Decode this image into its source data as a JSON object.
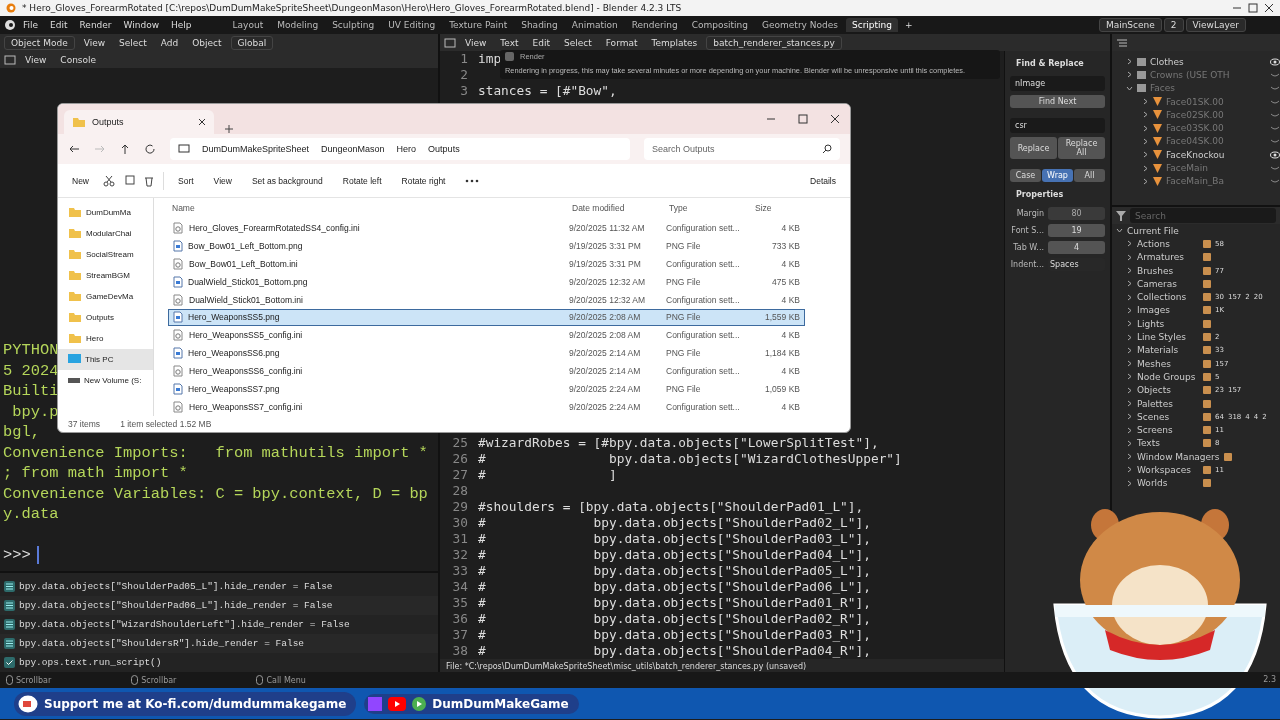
{
  "window": {
    "title": "* Hero_Gloves_ForearmRotated [C:\\repos\\DumDumMakeSpriteSheet\\DungeonMason\\Hero\\Hero_Gloves_ForearmRotated.blend] - Blender 4.2.3 LTS"
  },
  "menu": [
    "File",
    "Edit",
    "Render",
    "Window",
    "Help"
  ],
  "workspaces": [
    {
      "label": "Layout",
      "selected": false
    },
    {
      "label": "Modeling",
      "selected": false
    },
    {
      "label": "Sculpting",
      "selected": false
    },
    {
      "label": "UV Editing",
      "selected": false
    },
    {
      "label": "Texture Paint",
      "selected": false
    },
    {
      "label": "Shading",
      "selected": false
    },
    {
      "label": "Animation",
      "selected": false
    },
    {
      "label": "Rendering",
      "selected": false
    },
    {
      "label": "Compositing",
      "selected": false
    },
    {
      "label": "Geometry Nodes",
      "selected": false
    },
    {
      "label": "Scripting",
      "selected": true
    }
  ],
  "add_workspace": "+",
  "scene": {
    "name": "MainScene",
    "count": "2",
    "view_layer": "ViewLayer"
  },
  "viewport_header": {
    "mode": "Object Mode",
    "menus": [
      "View",
      "Select",
      "Add",
      "Object"
    ],
    "orientation": "Global"
  },
  "console": {
    "menus": [
      "View",
      "Console"
    ],
    "lines": [
      "PYTHON",
      "5 2024",
      "Builti",
      " bpy.p",
      "bgl,",
      "Convenience Imports:   from mathutils import *",
      "; from math import *",
      "Convenience Variables: C = bpy.context, D = bp",
      "y.data"
    ],
    "prompt": ">>>"
  },
  "info": [
    {
      "kind": "property",
      "text": "bpy.data.objects[\"ShoulderPad05_L\"].hide_render = False"
    },
    {
      "kind": "property",
      "text": "bpy.data.objects[\"ShoulderPad06_L\"].hide_render = False"
    },
    {
      "kind": "property",
      "text": "bpy.data.objects[\"WizardShoulderLeft\"].hide_render = False"
    },
    {
      "kind": "property",
      "text": "bpy.data.objects[\"ShouldersR\"].hide_render = False"
    },
    {
      "kind": "operator",
      "text": "bpy.ops.text.run_script()"
    }
  ],
  "text_editor": {
    "menus": [
      "View",
      "Text",
      "Edit",
      "Select",
      "Format",
      "Templates"
    ],
    "filename": "batch_renderer_stances.py",
    "lines_top": [
      {
        "n": "1",
        "text": "imp"
      },
      {
        "n": "2"
      },
      {
        "n": "3",
        "text": "stances = [#\"Bow\","
      }
    ],
    "lines_bottom": [
      {
        "n": "25",
        "text": "#wizardRobes = [#bpy.data.objects[\"LowerSplitTest\"],"
      },
      {
        "n": "26",
        "text": "#                bpy.data.objects[\"WizardClothesUpper\"]"
      },
      {
        "n": "27",
        "text": "#                ]"
      },
      {
        "n": "28"
      },
      {
        "n": "29",
        "text": "#shoulders = [bpy.data.objects[\"ShoulderPad01_L\"],"
      },
      {
        "n": "30",
        "text": "#              bpy.data.objects[\"ShoulderPad02_L\"],"
      },
      {
        "n": "31",
        "text": "#              bpy.data.objects[\"ShoulderPad03_L\"],"
      },
      {
        "n": "32",
        "text": "#              bpy.data.objects[\"ShoulderPad04_L\"],"
      },
      {
        "n": "33",
        "text": "#              bpy.data.objects[\"ShoulderPad05_L\"],"
      },
      {
        "n": "34",
        "text": "#              bpy.data.objects[\"ShoulderPad06_L\"],"
      },
      {
        "n": "35",
        "text": "#              bpy.data.objects[\"ShoulderPad01_R\"],"
      },
      {
        "n": "36",
        "text": "#              bpy.data.objects[\"ShoulderPad02_R\"],"
      },
      {
        "n": "37",
        "text": "#              bpy.data.objects[\"ShoulderPad03_R\"],"
      },
      {
        "n": "38",
        "text": "#              bpy.data.objects[\"ShoulderPad04_R\"],"
      }
    ],
    "status": "File: *C:\\repos\\DumDumMakeSpriteSheet\\misc_utils\\batch_renderer_stances.py (unsaved)"
  },
  "render_notice": {
    "title": "Render",
    "message": "Rendering in progress, this may take several minutes or more depending on your machine. Blender will be unresponsive until this completes."
  },
  "find_replace": {
    "title": "Find & Replace",
    "find": "nImage",
    "find_button": "Find Next",
    "replace": "csr",
    "replace_button": "Replace",
    "replace_all_button": "Replace All",
    "options": [
      {
        "label": "Case",
        "selected": false
      },
      {
        "label": "Wrap",
        "selected": true
      },
      {
        "label": "All",
        "selected": false
      }
    ],
    "properties_title": "Properties",
    "properties": [
      {
        "label": "Margin",
        "value": "80",
        "disabled": true
      },
      {
        "label": "Font S...",
        "value": "19",
        "disabled": false
      },
      {
        "label": "Tab W...",
        "value": "4",
        "disabled": false
      },
      {
        "label": "Indent...",
        "value": "Spaces",
        "disabled": false
      }
    ]
  },
  "outliner": {
    "items": [
      {
        "name": "Clothes",
        "expanded": false,
        "visible": true
      },
      {
        "name": "Crowns (USE OTH",
        "expanded": false,
        "visible": false
      },
      {
        "name": "Faces",
        "expanded": true,
        "visible": false,
        "children": [
          {
            "name": "Face01SK.00",
            "visible": false
          },
          {
            "name": "Face02SK.00",
            "visible": false
          },
          {
            "name": "Face03SK.00",
            "visible": false
          },
          {
            "name": "Face04SK.00",
            "visible": false
          },
          {
            "name": "FaceKnockou",
            "visible": true
          },
          {
            "name": "FaceMain",
            "visible": false
          },
          {
            "name": "FaceMain_Ba",
            "visible": false
          }
        ]
      }
    ]
  },
  "blend_file": {
    "search": "Search",
    "root": "Current File",
    "items": [
      {
        "name": "Actions",
        "counts": [
          "58"
        ]
      },
      {
        "name": "Armatures"
      },
      {
        "name": "Brushes",
        "counts": [
          "77"
        ]
      },
      {
        "name": "Cameras"
      },
      {
        "name": "Collections",
        "counts": [
          "30",
          "157",
          "2",
          "20"
        ]
      },
      {
        "name": "Images",
        "counts": [
          "1K"
        ]
      },
      {
        "name": "Lights"
      },
      {
        "name": "Line Styles",
        "counts": [
          "2"
        ]
      },
      {
        "name": "Materials",
        "counts": [
          "33"
        ]
      },
      {
        "name": "Meshes",
        "counts": [
          "157"
        ]
      },
      {
        "name": "Node Groups",
        "counts": [
          "5"
        ]
      },
      {
        "name": "Objects",
        "counts": [
          "23",
          "157"
        ]
      },
      {
        "name": "Palettes"
      },
      {
        "name": "Scenes",
        "counts": [
          "64",
          "318",
          "4",
          "4",
          "2"
        ]
      },
      {
        "name": "Screens",
        "counts": [
          "11"
        ]
      },
      {
        "name": "Texts",
        "counts": [
          "8"
        ]
      },
      {
        "name": "Window Managers"
      },
      {
        "name": "Workspaces",
        "counts": [
          "11"
        ]
      },
      {
        "name": "Worlds"
      }
    ]
  },
  "status_bar": {
    "hints": [
      "Scrollbar",
      "Scrollbar",
      "Call Menu"
    ],
    "version": "2.3"
  },
  "explorer": {
    "tab": "Outputs",
    "breadcrumbs": [
      "DumDumMakeSpriteSheet",
      "DungeonMason",
      "Hero",
      "Outputs"
    ],
    "search_placeholder": "Search Outputs",
    "toolbar": [
      "New",
      "Sort",
      "View",
      "Set as background",
      "Rotate left",
      "Rotate right"
    ],
    "details": "Details",
    "sidebar": [
      {
        "name": "DumDumMa",
        "kind": "folder",
        "selected": false
      },
      {
        "name": "ModularChai",
        "kind": "folder",
        "selected": false
      },
      {
        "name": "SocialStream",
        "kind": "folder",
        "selected": false
      },
      {
        "name": "StreamBGM",
        "kind": "folder",
        "selected": false
      },
      {
        "name": "GameDevMa",
        "kind": "folder",
        "selected": false
      },
      {
        "name": "Outputs",
        "kind": "folder",
        "selected": false
      },
      {
        "name": "Hero",
        "kind": "folder",
        "selected": false
      },
      {
        "name": "This PC",
        "kind": "pc",
        "selected": true
      },
      {
        "name": "New Volume (S:",
        "kind": "drive",
        "selected": false
      }
    ],
    "columns": [
      "Name",
      "Date modified",
      "Type",
      "Size"
    ],
    "files": [
      {
        "name": "Hero_Gloves_ForearmRotatedSS4_config.ini",
        "date": "9/20/2025 11:32 AM",
        "type": "Configuration sett...",
        "size": "4 KB",
        "kind": "config",
        "selected": false
      },
      {
        "name": "Bow_Bow01_Left_Bottom.png",
        "date": "9/19/2025 3:31 PM",
        "type": "PNG File",
        "size": "733 KB",
        "kind": "image",
        "selected": false
      },
      {
        "name": "Bow_Bow01_Left_Bottom.ini",
        "date": "9/19/2025 3:31 PM",
        "type": "Configuration sett...",
        "size": "4 KB",
        "kind": "config",
        "selected": false
      },
      {
        "name": "DualWield_Stick01_Bottom.png",
        "date": "9/20/2025 12:32 AM",
        "type": "PNG File",
        "size": "475 KB",
        "kind": "image",
        "selected": false
      },
      {
        "name": "DualWield_Stick01_Bottom.ini",
        "date": "9/20/2025 12:32 AM",
        "type": "Configuration sett...",
        "size": "4 KB",
        "kind": "config",
        "selected": false
      },
      {
        "name": "Hero_WeaponsSS5.png",
        "date": "9/20/2025 2:08 AM",
        "type": "PNG File",
        "size": "1,559 KB",
        "kind": "image",
        "selected": true
      },
      {
        "name": "Hero_WeaponsSS5_config.ini",
        "date": "9/20/2025 2:08 AM",
        "type": "Configuration sett...",
        "size": "4 KB",
        "kind": "config",
        "selected": false
      },
      {
        "name": "Hero_WeaponsSS6.png",
        "date": "9/20/2025 2:14 AM",
        "type": "PNG File",
        "size": "1,184 KB",
        "kind": "image",
        "selected": false
      },
      {
        "name": "Hero_WeaponsSS6_config.ini",
        "date": "9/20/2025 2:14 AM",
        "type": "Configuration sett...",
        "size": "4 KB",
        "kind": "config",
        "selected": false
      },
      {
        "name": "Hero_WeaponsSS7.png",
        "date": "9/20/2025 2:24 AM",
        "type": "PNG File",
        "size": "1,059 KB",
        "kind": "image",
        "selected": false
      },
      {
        "name": "Hero_WeaponsSS7_config.ini",
        "date": "9/20/2025 2:24 AM",
        "type": "Configuration sett...",
        "size": "4 KB",
        "kind": "config",
        "selected": false
      }
    ],
    "item_count": "37 items",
    "selection": "1 item selected  1.52 MB"
  },
  "stream_bar": {
    "support": "Support me at Ko-fi.com/dumdummakegame",
    "channel": "DumDumMakeGame"
  }
}
